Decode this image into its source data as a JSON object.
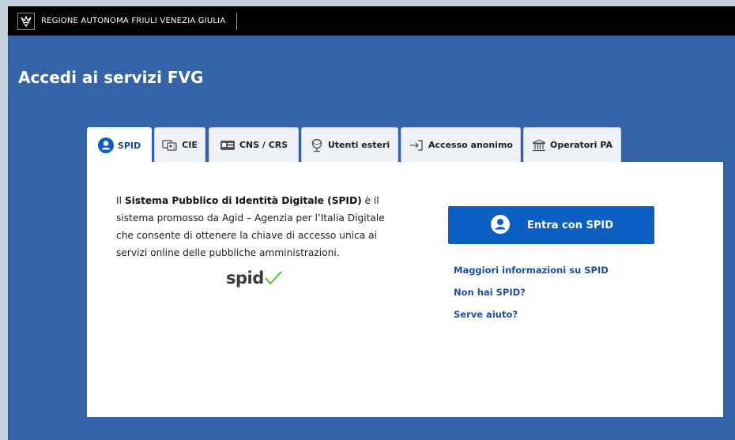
{
  "topbar": {
    "region_name": "REGIONE AUTONOMA FRIULI VENEZIA GIULIA"
  },
  "page": {
    "title": "Accedi ai servizi FVG"
  },
  "tabs": [
    {
      "label": "SPID",
      "icon": "user-circle-icon",
      "active": true
    },
    {
      "label": "CIE",
      "icon": "id-card-icon",
      "active": false
    },
    {
      "label": "CNS / CRS",
      "icon": "smart-card-icon",
      "active": false
    },
    {
      "label": "Utenti esteri",
      "icon": "globe-icon",
      "active": false
    },
    {
      "label": "Accesso anonimo",
      "icon": "sign-in-icon",
      "active": false
    },
    {
      "label": "Operatori PA",
      "icon": "institution-icon",
      "active": false
    }
  ],
  "spid_panel": {
    "description_prefix": "Il ",
    "description_bold": "Sistema Pubblico di Identità Digitale (SPID)",
    "description_rest": " è il sistema promosso da Agid – Agenzia per l’Italia Digitale che consente di ottenere la chiave di accesso unica ai servizi online delle pubbliche amministrazioni.",
    "logo_text": "spid",
    "login_button_label": "Entra con SPID",
    "links": [
      "Maggiori informazioni su SPID",
      "Non hai SPID?",
      "Serve aiuto?"
    ]
  },
  "colors": {
    "page_background": "#3463a8",
    "topbar": "#000000",
    "primary_button": "#0b5fc2",
    "link": "#1e4f96",
    "spid_check": "#6cc24a"
  }
}
